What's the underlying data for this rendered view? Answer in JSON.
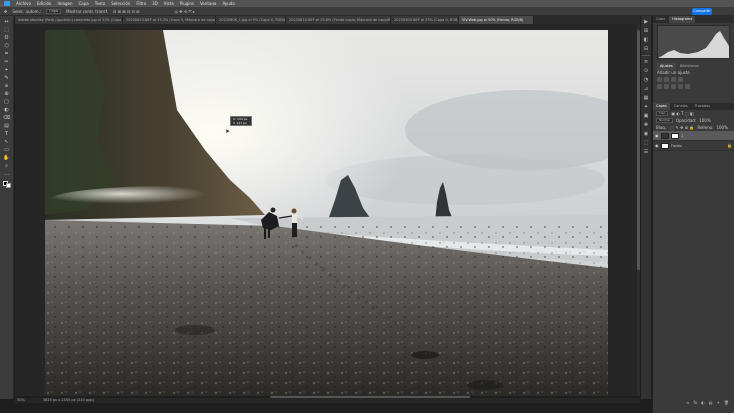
{
  "menubar": {
    "items": [
      "Archivo",
      "Edición",
      "Imagen",
      "Capa",
      "Texto",
      "Selección",
      "Filtro",
      "3D",
      "Vista",
      "Plugins",
      "Ventana",
      "Ayuda"
    ]
  },
  "options": {
    "autoselect_label": "Selec. autom.:",
    "autoselect_value": "Capa",
    "transform_label": "Mostrar contr. transf."
  },
  "share_label": "Compartir",
  "tabs": [
    "Adobe stockby (Red) (AppleUn) completo.jpg al 33% (Capa 1, RGB/8)",
    "20230610.NEF al 33,3% (Capa 0, Máscara de capa/8)",
    "20230608_1.jpg al 9% (Capa 0, RGB/8)",
    "20230610.NEF al 25,6% (Fondo copia, Máscara de capa/8)",
    "20230309.NEF al 33% (Capa 0, RGB/8)",
    "VIV.Web.jpg al 50% (Fondo, RGB/8)"
  ],
  "tools": [
    "↔",
    "⬚",
    "ʘ",
    "⬡",
    "⌗",
    "✂",
    "⌖",
    "✎",
    "⌀",
    "⊕",
    "▢",
    "◐",
    "⌫",
    "▤",
    "T",
    "↖",
    "▭",
    "✋",
    "⌕",
    "…"
  ],
  "status": {
    "zoom": "50%",
    "dims": "3828 px x 2555 px (240 ppp)"
  },
  "tooltip": {
    "line1": "X: 134 px",
    "line2": "Y: 127 px"
  },
  "rail_icons": [
    "▶",
    "⊞",
    "◧",
    "⊟",
    "≡",
    "⊙",
    "◔",
    "⊿",
    "▦",
    "✦",
    "▣",
    "✚",
    "◉",
    "⬚",
    "☰"
  ],
  "panels": {
    "top_tabs": [
      "Color",
      "Histograma"
    ],
    "adjust_tabs": [
      "Ajustes",
      "Bibliotecas"
    ],
    "adjust_label": "Añadir un ajuste",
    "layer_tabs": [
      "Capas",
      "Canales",
      "Trazados"
    ],
    "filter_label": "Tipo",
    "blend_mode": "Normal",
    "opacity_label": "Opacidad:",
    "opacity_value": "100%",
    "lock_label": "Bloq.:",
    "fill_label": "Relleno:",
    "fill_value": "100%",
    "layers": [
      {
        "name": "1",
        "selected": true
      },
      {
        "name": "Fondo",
        "selected": false
      }
    ],
    "footer_icons": [
      "fx",
      "◐",
      "▤",
      "+",
      "🗑"
    ]
  }
}
